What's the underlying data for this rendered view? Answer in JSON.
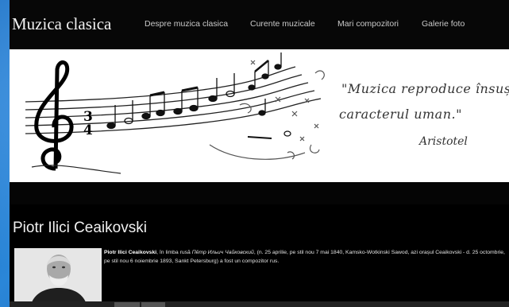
{
  "header": {
    "title": "Muzica clasica",
    "nav": [
      {
        "label": "Despre muzica clasica"
      },
      {
        "label": "Curente muzicale"
      },
      {
        "label": "Mari compozitori"
      },
      {
        "label": "Galerie foto"
      }
    ]
  },
  "banner": {
    "quote_line1": "\"Muzica reproduce însuși",
    "quote_line2": "caracterul uman.\"",
    "quote_author": "Aristotel",
    "time_signature_top": "3",
    "time_signature_bottom": "4"
  },
  "article": {
    "title": "Piotr Ilici Ceaikovski",
    "bio_name": "Piotr Ilici Ceaikovski",
    "bio_text_1": ", în limba rusă ",
    "bio_russian": "Пётр Ильич Чайковский",
    "bio_text_2": ", (n. 25 aprilie, pe stil nou 7 mai 1840, Kamsko-Wotkinski Sawod, azi orașul Ceaikovski - d. 25 octombrie, pe stil nou 6 noiembrie 1893, Sankt Petersburg) a fost un compozitor rus."
  },
  "colors": {
    "background": "#1b6fc2",
    "page": "#000000",
    "nav_text": "#c9c9c9"
  }
}
